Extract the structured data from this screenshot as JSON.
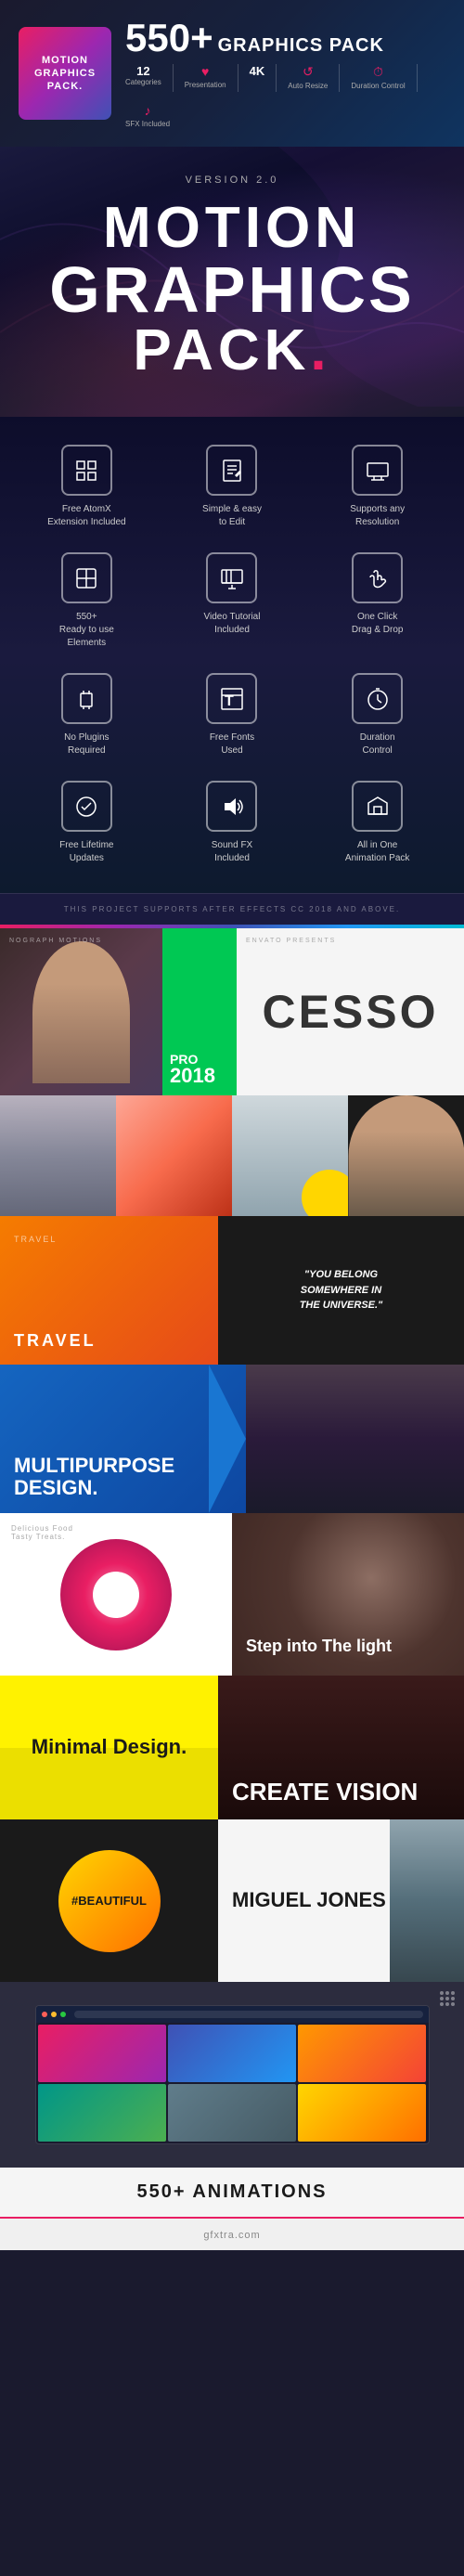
{
  "topBanner": {
    "bigNumber": "550+",
    "packTitle": "GRAPHICS PACK",
    "stats": [
      {
        "icon": "12",
        "label": "Categories"
      },
      {
        "icon": "♥",
        "label": "Presentation"
      },
      {
        "icon": "4K",
        "label": ""
      },
      {
        "icon": "↺",
        "label": "Auto Resize"
      },
      {
        "icon": "⏱",
        "label": "Duration Control"
      },
      {
        "icon": "♪",
        "label": "SFX Included"
      }
    ],
    "productBox": {
      "line1": "MOTION",
      "line2": "GRAPHICS",
      "line3": "PACK."
    }
  },
  "hero": {
    "version": "VERSION 2.0",
    "line1": "MOTION",
    "line2": "GRAPHICS",
    "line3": "PACK."
  },
  "features": [
    {
      "icon": "box",
      "label": "Free AtomX\nExtension Included"
    },
    {
      "icon": "pencil",
      "label": "Simple & easy\nto Edit"
    },
    {
      "icon": "monitor",
      "label": "Supports any\nResolution"
    },
    {
      "icon": "layers",
      "label": "550+\nReady to use\nElements"
    },
    {
      "icon": "film",
      "label": "Video Tutorial\nIncluded"
    },
    {
      "icon": "touch",
      "label": "One Click\nDrag & Drop"
    },
    {
      "icon": "plug",
      "label": "No Plugins\nRequired"
    },
    {
      "icon": "font",
      "label": "Free Fonts\nUsed"
    },
    {
      "icon": "clock",
      "label": "Duration\nControl"
    },
    {
      "icon": "check",
      "label": "Free Lifetime\nUpdates"
    },
    {
      "icon": "sound",
      "label": "Sound FX\nIncluded"
    },
    {
      "icon": "gift",
      "label": "All in One\nAnimation Pack"
    }
  ],
  "projectNote": "THIS PROJECT SUPPORTS AFTER EFFECTS CC 2018 AND ABOVE.",
  "previews": {
    "preview1": {
      "brand": "NOGRAPH MOTIONS",
      "envato": "ENVATO PRESENTS",
      "pro": "PRO",
      "year": "2018",
      "cesso": "CESSO"
    },
    "preview3": {
      "travel": "TRAVEL",
      "quote": "\"YOU BELONG\nSOMEWHERE IN\nTHE UNIVERSE.\""
    },
    "preview4": {
      "multipurpose": "MULTIPURPOSE\nDESIGN."
    },
    "preview5": {
      "foodLabel": "Delicious Food\nTasty Treats.",
      "stepInto": "Step into\nThe light"
    },
    "preview6": {
      "minimal": "Minimal Design.",
      "create": "CREATE\nVISION"
    },
    "preview7": {
      "beautiful": "#BEAUTIFUL",
      "miguel": "MIGUEL\nJONES"
    },
    "bottom": {
      "animations": "550+ ANIMATIONS"
    }
  },
  "colors": {
    "accent": "#e91e63",
    "green": "#00c853",
    "blue": "#1565c0",
    "yellow": "#fff200",
    "dark": "#1a1a2e"
  }
}
